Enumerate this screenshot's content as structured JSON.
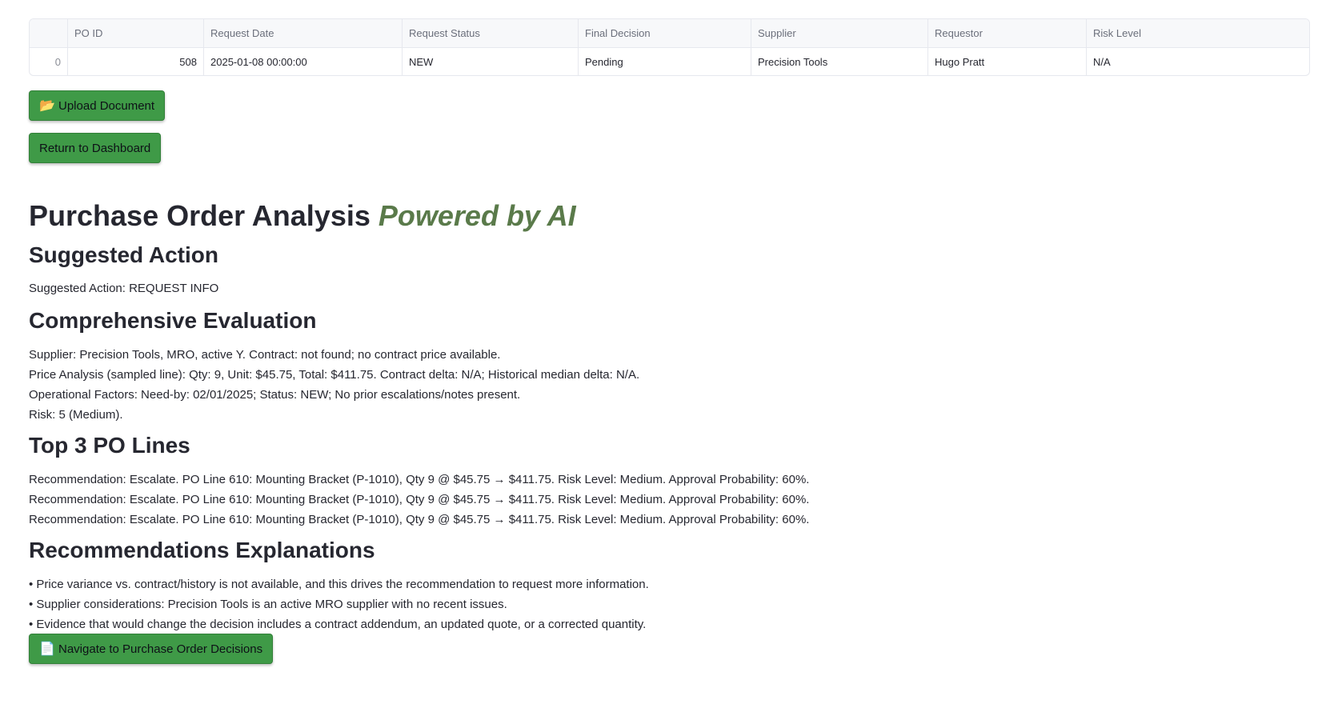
{
  "table": {
    "headers": [
      "",
      "PO ID",
      "Request Date",
      "Request Status",
      "Final Decision",
      "Supplier",
      "Requestor",
      "Risk Level"
    ],
    "row": {
      "index": "0",
      "po_id": "508",
      "request_date": "2025-01-08 00:00:00",
      "request_status": "NEW",
      "final_decision": "Pending",
      "supplier": "Precision Tools",
      "requestor": "Hugo Pratt",
      "risk_level": "N/A"
    }
  },
  "buttons": {
    "upload": "Upload Document",
    "upload_icon": "📂",
    "return": "Return to Dashboard",
    "navigate": "Navigate to Purchase Order Decisions",
    "navigate_icon": "📄"
  },
  "title": {
    "main": "Purchase Order Analysis",
    "highlight": "Powered by AI"
  },
  "suggested_action": {
    "heading": "Suggested Action",
    "text": "Suggested Action: REQUEST INFO"
  },
  "evaluation": {
    "heading": "Comprehensive Evaluation",
    "lines": [
      "Supplier: Precision Tools, MRO, active Y. Contract: not found; no contract price available.",
      "Price Analysis (sampled line): Qty: 9, Unit: $45.75, Total: $411.75. Contract delta: N/A; Historical median delta: N/A.",
      "Operational Factors: Need-by: 02/01/2025; Status: NEW; No prior escalations/notes present.",
      "Risk: 5 (Medium)."
    ]
  },
  "po_lines": {
    "heading": "Top 3 PO Lines",
    "lines": [
      "Recommendation: Escalate. PO Line 610: Mounting Bracket (P-1010), Qty 9 @ $45.75 → $411.75. Risk Level: Medium. Approval Probability: 60%.",
      "Recommendation: Escalate. PO Line 610: Mounting Bracket (P-1010), Qty 9 @ $45.75 → $411.75. Risk Level: Medium. Approval Probability: 60%.",
      "Recommendation: Escalate. PO Line 610: Mounting Bracket (P-1010), Qty 9 @ $45.75 → $411.75. Risk Level: Medium. Approval Probability: 60%."
    ]
  },
  "explanations": {
    "heading": "Recommendations Explanations",
    "lines": [
      "• Price variance vs. contract/history is not available, and this drives the recommendation to request more information.",
      "• Supplier considerations: Precision Tools is an active MRO supplier with no recent issues.",
      "• Evidence that would change the decision includes a contract addendum, an updated quote, or a corrected quantity."
    ]
  },
  "colors": {
    "button_bg": "#3f9a47",
    "ai_highlight": "#5a7a4a"
  }
}
